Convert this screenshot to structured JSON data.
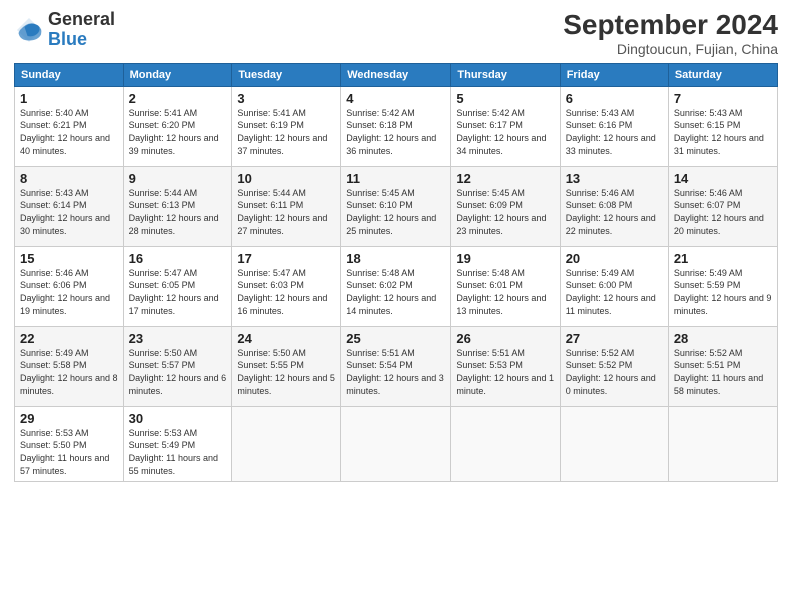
{
  "header": {
    "logo_general": "General",
    "logo_blue": "Blue",
    "month_title": "September 2024",
    "subtitle": "Dingtoucun, Fujian, China"
  },
  "weekdays": [
    "Sunday",
    "Monday",
    "Tuesday",
    "Wednesday",
    "Thursday",
    "Friday",
    "Saturday"
  ],
  "weeks": [
    [
      {
        "day": "1",
        "sunrise": "5:40 AM",
        "sunset": "6:21 PM",
        "daylight": "12 hours and 40 minutes."
      },
      {
        "day": "2",
        "sunrise": "5:41 AM",
        "sunset": "6:20 PM",
        "daylight": "12 hours and 39 minutes."
      },
      {
        "day": "3",
        "sunrise": "5:41 AM",
        "sunset": "6:19 PM",
        "daylight": "12 hours and 37 minutes."
      },
      {
        "day": "4",
        "sunrise": "5:42 AM",
        "sunset": "6:18 PM",
        "daylight": "12 hours and 36 minutes."
      },
      {
        "day": "5",
        "sunrise": "5:42 AM",
        "sunset": "6:17 PM",
        "daylight": "12 hours and 34 minutes."
      },
      {
        "day": "6",
        "sunrise": "5:43 AM",
        "sunset": "6:16 PM",
        "daylight": "12 hours and 33 minutes."
      },
      {
        "day": "7",
        "sunrise": "5:43 AM",
        "sunset": "6:15 PM",
        "daylight": "12 hours and 31 minutes."
      }
    ],
    [
      {
        "day": "8",
        "sunrise": "5:43 AM",
        "sunset": "6:14 PM",
        "daylight": "12 hours and 30 minutes."
      },
      {
        "day": "9",
        "sunrise": "5:44 AM",
        "sunset": "6:13 PM",
        "daylight": "12 hours and 28 minutes."
      },
      {
        "day": "10",
        "sunrise": "5:44 AM",
        "sunset": "6:11 PM",
        "daylight": "12 hours and 27 minutes."
      },
      {
        "day": "11",
        "sunrise": "5:45 AM",
        "sunset": "6:10 PM",
        "daylight": "12 hours and 25 minutes."
      },
      {
        "day": "12",
        "sunrise": "5:45 AM",
        "sunset": "6:09 PM",
        "daylight": "12 hours and 23 minutes."
      },
      {
        "day": "13",
        "sunrise": "5:46 AM",
        "sunset": "6:08 PM",
        "daylight": "12 hours and 22 minutes."
      },
      {
        "day": "14",
        "sunrise": "5:46 AM",
        "sunset": "6:07 PM",
        "daylight": "12 hours and 20 minutes."
      }
    ],
    [
      {
        "day": "15",
        "sunrise": "5:46 AM",
        "sunset": "6:06 PM",
        "daylight": "12 hours and 19 minutes."
      },
      {
        "day": "16",
        "sunrise": "5:47 AM",
        "sunset": "6:05 PM",
        "daylight": "12 hours and 17 minutes."
      },
      {
        "day": "17",
        "sunrise": "5:47 AM",
        "sunset": "6:03 PM",
        "daylight": "12 hours and 16 minutes."
      },
      {
        "day": "18",
        "sunrise": "5:48 AM",
        "sunset": "6:02 PM",
        "daylight": "12 hours and 14 minutes."
      },
      {
        "day": "19",
        "sunrise": "5:48 AM",
        "sunset": "6:01 PM",
        "daylight": "12 hours and 13 minutes."
      },
      {
        "day": "20",
        "sunrise": "5:49 AM",
        "sunset": "6:00 PM",
        "daylight": "12 hours and 11 minutes."
      },
      {
        "day": "21",
        "sunrise": "5:49 AM",
        "sunset": "5:59 PM",
        "daylight": "12 hours and 9 minutes."
      }
    ],
    [
      {
        "day": "22",
        "sunrise": "5:49 AM",
        "sunset": "5:58 PM",
        "daylight": "12 hours and 8 minutes."
      },
      {
        "day": "23",
        "sunrise": "5:50 AM",
        "sunset": "5:57 PM",
        "daylight": "12 hours and 6 minutes."
      },
      {
        "day": "24",
        "sunrise": "5:50 AM",
        "sunset": "5:55 PM",
        "daylight": "12 hours and 5 minutes."
      },
      {
        "day": "25",
        "sunrise": "5:51 AM",
        "sunset": "5:54 PM",
        "daylight": "12 hours and 3 minutes."
      },
      {
        "day": "26",
        "sunrise": "5:51 AM",
        "sunset": "5:53 PM",
        "daylight": "12 hours and 1 minute."
      },
      {
        "day": "27",
        "sunrise": "5:52 AM",
        "sunset": "5:52 PM",
        "daylight": "12 hours and 0 minutes."
      },
      {
        "day": "28",
        "sunrise": "5:52 AM",
        "sunset": "5:51 PM",
        "daylight": "11 hours and 58 minutes."
      }
    ],
    [
      {
        "day": "29",
        "sunrise": "5:53 AM",
        "sunset": "5:50 PM",
        "daylight": "11 hours and 57 minutes."
      },
      {
        "day": "30",
        "sunrise": "5:53 AM",
        "sunset": "5:49 PM",
        "daylight": "11 hours and 55 minutes."
      },
      null,
      null,
      null,
      null,
      null
    ]
  ]
}
